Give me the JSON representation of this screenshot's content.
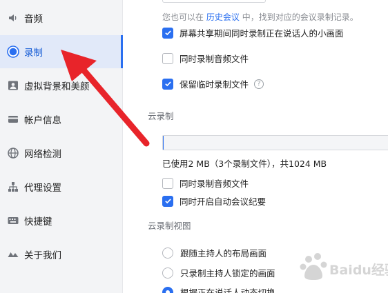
{
  "sidebar": {
    "items": [
      {
        "label": "音频",
        "icon": "speaker-icon"
      },
      {
        "label": "录制",
        "icon": "record-icon",
        "active": true
      },
      {
        "label": "虚拟背景和美颜",
        "icon": "portrait-icon"
      },
      {
        "label": "帐户信息",
        "icon": "card-icon"
      },
      {
        "label": "网络检测",
        "icon": "globe-icon"
      },
      {
        "label": "代理设置",
        "icon": "network-icon"
      },
      {
        "label": "快捷键",
        "icon": "keyboard-icon"
      },
      {
        "label": "关于我们",
        "icon": "logo-icon"
      }
    ]
  },
  "local": {
    "hint_prefix": "您也可以在",
    "hint_link": "历史会议",
    "hint_suffix": "中，找到对应的会议录制记录。",
    "options": [
      {
        "label": "屏幕共享期间同时录制正在说话人的小画面",
        "checked": true
      },
      {
        "label": "同时录制音频文件",
        "checked": false
      },
      {
        "label": "保留临时录制文件",
        "checked": true,
        "help": "?"
      }
    ]
  },
  "cloud": {
    "title": "云录制",
    "usage_fraction": 0.002,
    "usage_text": "已使用2 MB（3个录制文件），共1024 MB",
    "options": [
      {
        "label": "同时录制音频文件",
        "checked": false
      },
      {
        "label": "同时开启自动会议纪要",
        "checked": true
      }
    ]
  },
  "cloud_view": {
    "title": "云录制视图",
    "options": [
      {
        "label": "跟随主持人的布局画面",
        "checked": false
      },
      {
        "label": "只录制主持人锁定的画面",
        "checked": false
      },
      {
        "label": "根据正在说话人动态切换",
        "checked": true
      }
    ]
  },
  "colors": {
    "accent": "#2a6ff0",
    "arrow": "#e8242a"
  },
  "watermark": {
    "text": "Baidu经验"
  }
}
